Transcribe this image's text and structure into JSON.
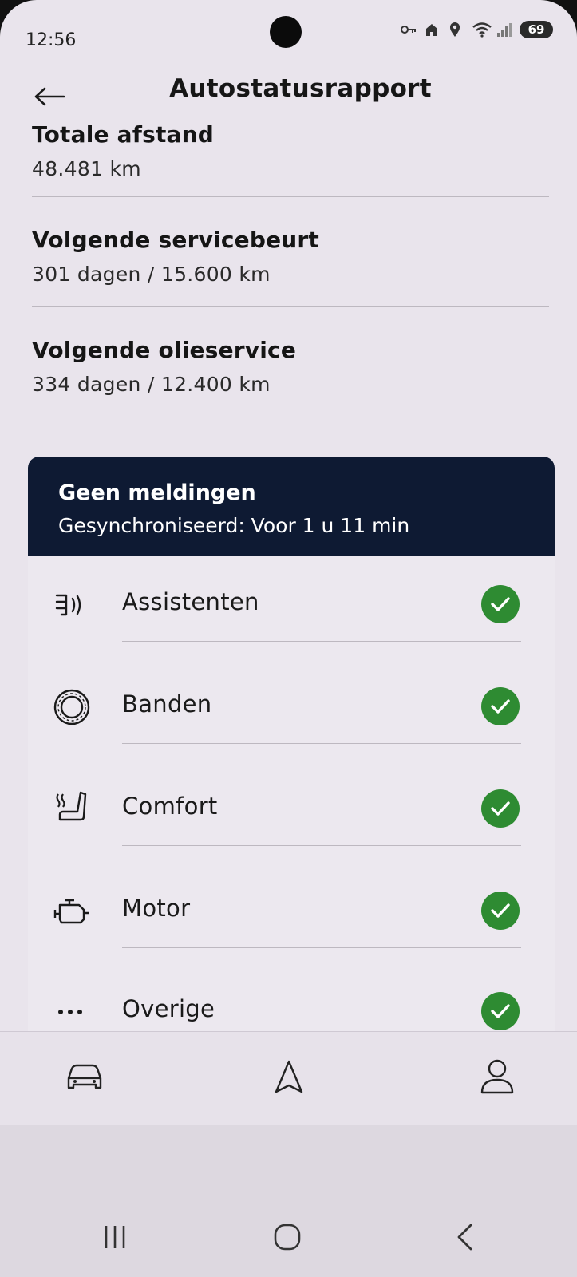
{
  "status_bar": {
    "time": "12:56",
    "battery": "69",
    "icons": [
      "key-icon",
      "home-icon",
      "location-icon",
      "wifi-icon",
      "signal-icon"
    ]
  },
  "header": {
    "title": "Autostatusrapport",
    "back_icon": "arrow-left-icon"
  },
  "info": [
    {
      "label": "Totale afstand",
      "value": "48.481 km"
    },
    {
      "label": "Volgende servicebeurt",
      "value": "301 dagen / 15.600 km"
    },
    {
      "label": "Volgende olieservice",
      "value": "334 dagen / 12.400 km"
    }
  ],
  "status_card": {
    "title": "Geen meldingen",
    "subtitle": "Gesynchroniseerd: Voor 1 u 11 min",
    "rows": [
      {
        "label": "Assistenten",
        "icon": "assistants-icon",
        "status": "ok"
      },
      {
        "label": "Banden",
        "icon": "tire-icon",
        "status": "ok"
      },
      {
        "label": "Comfort",
        "icon": "heated-seat-icon",
        "status": "ok"
      },
      {
        "label": "Motor",
        "icon": "engine-icon",
        "status": "ok"
      },
      {
        "label": "Overige",
        "icon": "more-dots-icon",
        "status": "ok"
      }
    ],
    "ok_color": "#2e8b32",
    "header_color": "#0e1a33"
  },
  "bottom_nav": {
    "items": [
      "car-icon",
      "navigation-icon",
      "profile-icon"
    ]
  },
  "system_nav": {
    "items": [
      "recent-apps-icon",
      "home-button-icon",
      "back-icon"
    ]
  }
}
